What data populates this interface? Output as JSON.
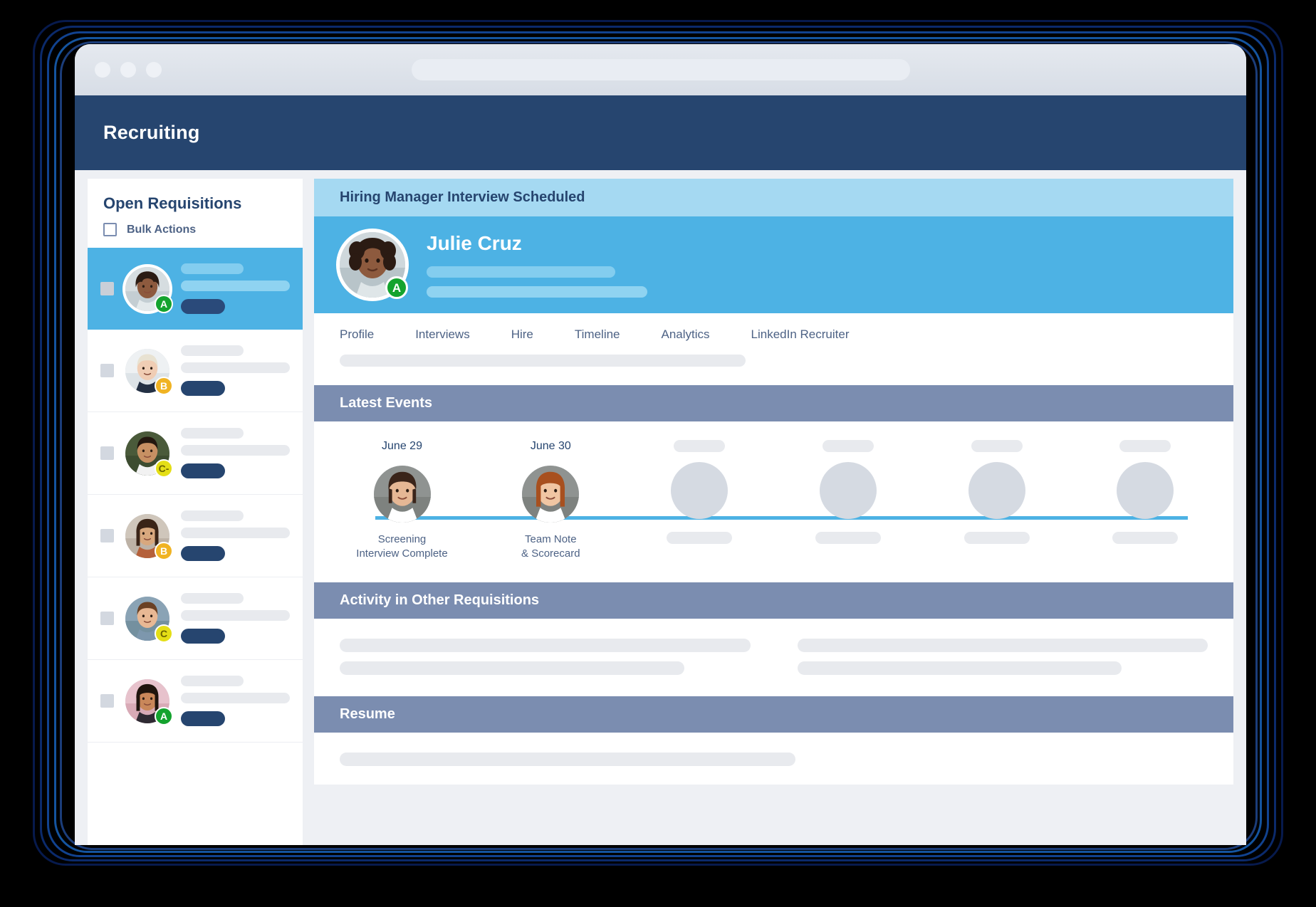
{
  "window": {
    "traffic_lights": [
      "close",
      "minimize",
      "maximize"
    ],
    "url_placeholder": ""
  },
  "app": {
    "title": "Recruiting",
    "header_color": "#26456f",
    "accent_color": "#4db2e4"
  },
  "sidebar": {
    "title": "Open Requisitions",
    "bulk_actions_label": "Bulk Actions",
    "bulk_actions_checked": false,
    "rows": [
      {
        "grade": "A",
        "grade_color": "#14a32e",
        "selected": true,
        "checked": false
      },
      {
        "grade": "B",
        "grade_color": "#f0b323",
        "selected": false,
        "checked": false
      },
      {
        "grade": "C-",
        "grade_color": "#e4de16",
        "selected": false,
        "checked": false
      },
      {
        "grade": "B",
        "grade_color": "#f0b323",
        "selected": false,
        "checked": false
      },
      {
        "grade": "C",
        "grade_color": "#e4de16",
        "selected": false,
        "checked": false
      },
      {
        "grade": "A",
        "grade_color": "#14a32e",
        "selected": false,
        "checked": false
      }
    ]
  },
  "main": {
    "status_label": "Hiring Manager Interview Scheduled",
    "candidate": {
      "name": "Julie Cruz",
      "grade": "A",
      "grade_color": "#14a32e"
    },
    "tabs": [
      {
        "label": "Profile",
        "active": true
      },
      {
        "label": "Interviews",
        "active": false
      },
      {
        "label": "Hire",
        "active": false
      },
      {
        "label": "Timeline",
        "active": false
      },
      {
        "label": "Analytics",
        "active": false
      },
      {
        "label": "LinkedIn Recruiter",
        "active": false
      }
    ],
    "sections": [
      {
        "title": "Latest Events"
      },
      {
        "title": "Activity in Other Requisitions"
      },
      {
        "title": "Resume"
      }
    ],
    "timeline": {
      "line_color": "#4db2e4",
      "events": [
        {
          "date": "June 29",
          "label": "Screening\nInterview Complete",
          "placeholder": false
        },
        {
          "date": "June 30",
          "label": "Team Note\n& Scorecard",
          "placeholder": false
        },
        {
          "date": "",
          "label": "",
          "placeholder": true
        },
        {
          "date": "",
          "label": "",
          "placeholder": true
        },
        {
          "date": "",
          "label": "",
          "placeholder": true
        },
        {
          "date": "",
          "label": "",
          "placeholder": true
        }
      ]
    }
  }
}
